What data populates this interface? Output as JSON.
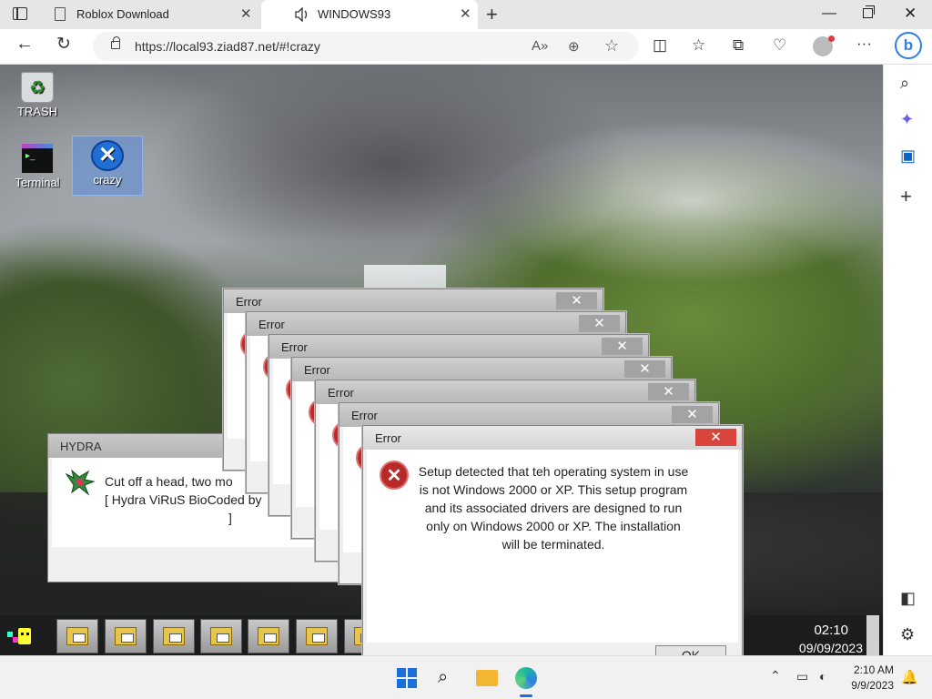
{
  "tabs": [
    {
      "title": "Roblox Download",
      "close": "✕"
    },
    {
      "title": "WINDOWS93",
      "close": "✕"
    }
  ],
  "browser": {
    "url": "https://local93.ziad87.net/#!crazy",
    "new_tab": "+",
    "minimize": "—",
    "close": "✕",
    "back": "←",
    "refresh": "↻",
    "read_aloud": "A»",
    "zoom": "⊕",
    "favorite": "☆",
    "split": "◫",
    "favorites": "☆",
    "collections": "⧉",
    "copilot": "♡",
    "more": "···",
    "bing": "b"
  },
  "sidebar": {
    "search": "⌕",
    "tools": "✦",
    "outlook": "▣",
    "add": "+",
    "panel": "◧",
    "settings": "⚙"
  },
  "desktop_icons": [
    {
      "label": "TRASH"
    },
    {
      "label": "Terminal"
    },
    {
      "label": "crazy",
      "glyph": "✕"
    }
  ],
  "stacked_errors": [
    {
      "title": "Error",
      "close": "✕"
    },
    {
      "title": "Error",
      "close": "✕"
    },
    {
      "title": "Error",
      "close": "✕"
    },
    {
      "title": "Error",
      "close": "✕"
    },
    {
      "title": "Error",
      "close": "✕"
    },
    {
      "title": "Error",
      "close": "✕"
    }
  ],
  "error_dialog": {
    "title": "Error",
    "close": "✕",
    "icon": "✕",
    "message": "Setup detected that teh operating system in use is not Windows 2000 or XP. This setup program and its associated drivers are designed to run only on Windows 2000 or XP. The installation will be terminated.",
    "ok_label": "OK"
  },
  "hydra": {
    "title": "HYDRA",
    "line1": "Cut off a head, two mo",
    "line2": "[ Hydra ViRuS BioCoded by",
    "line3": "]"
  },
  "w93_taskbar": {
    "task_count": 8,
    "time": "02:10",
    "date": "09/09/2023"
  },
  "os_taskbar": {
    "search": "⌕",
    "chevron": "⌃",
    "network": "▭",
    "volume": "◐",
    "time": "2:10 AM",
    "date": "9/9/2023",
    "bell": "🔔"
  }
}
